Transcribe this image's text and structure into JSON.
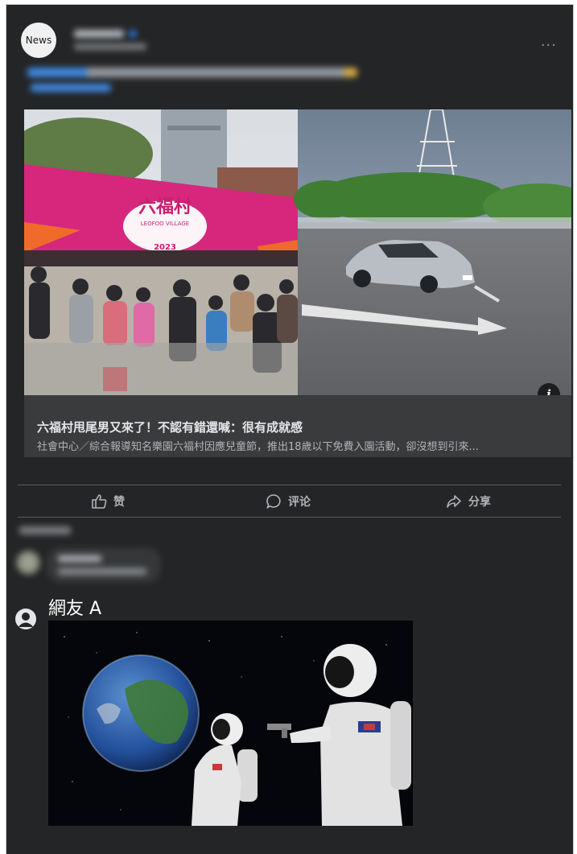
{
  "post": {
    "avatar_text": "News",
    "link_card": {
      "title": "六福村甩尾男又來了！不認有錯還喊：很有成就感",
      "description": "社會中心／綜合報導知名樂園六福村因應兒童節，推出18歲以下免費入園活動，卻沒想到引來...",
      "sign_line_1": "六福村",
      "sign_line_2": "LEOFOO VILLAGE",
      "sign_line_3": "2023"
    },
    "actions": {
      "like": "赞",
      "comment": "评论",
      "share": "分享"
    }
  },
  "comment": {
    "author": "網友 A"
  },
  "colors": {
    "panel": "#242526",
    "card": "#3a3b3c",
    "text_primary": "#e4e6eb",
    "text_secondary": "#b0b3b8",
    "link_blue": "#4599ff"
  },
  "icons": [
    "more-icon",
    "info-icon",
    "like-icon",
    "comment-icon",
    "share-icon",
    "user-icon",
    "verified-icon"
  ]
}
